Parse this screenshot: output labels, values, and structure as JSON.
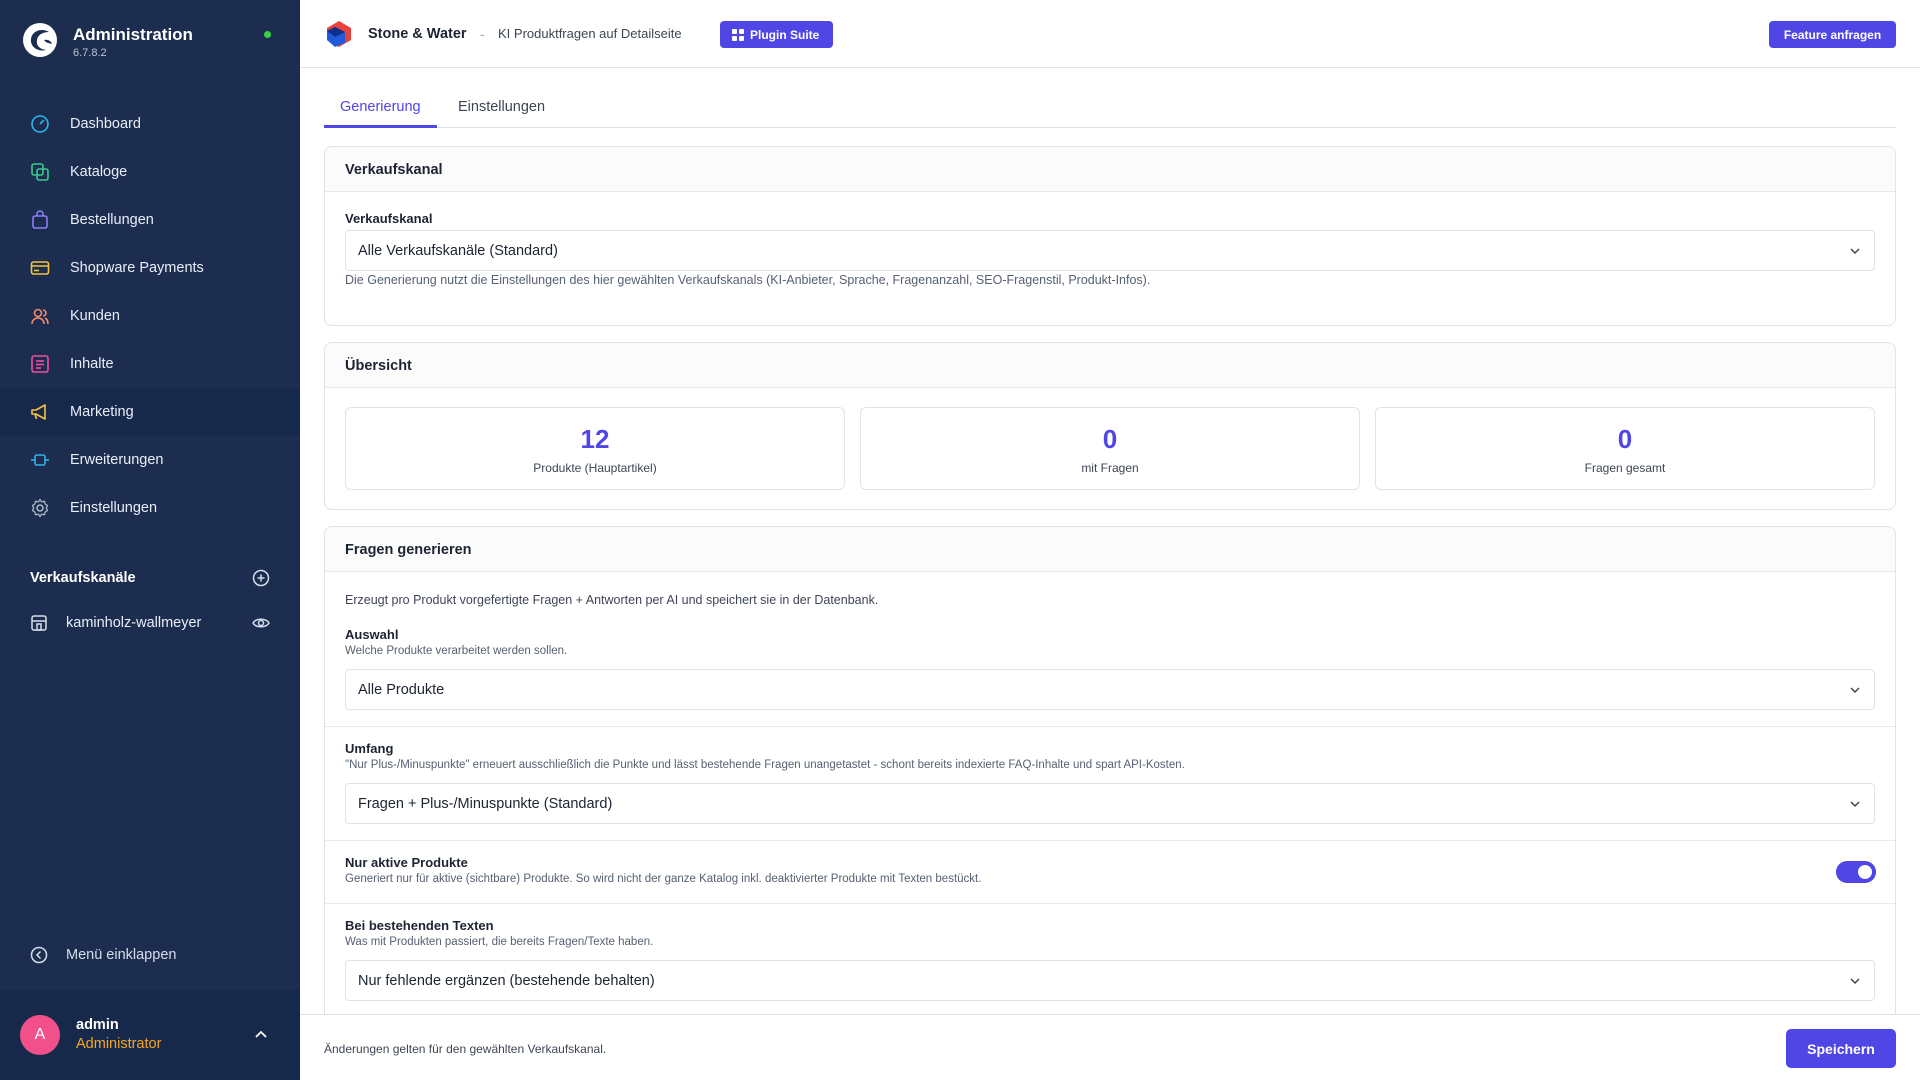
{
  "app": {
    "title": "Administration",
    "version": "6.7.8.2",
    "status_color": "#37d046"
  },
  "sidebar": {
    "items": [
      {
        "label": "Dashboard",
        "icon": "dashboard-icon",
        "color": "#2fb5e8"
      },
      {
        "label": "Kataloge",
        "icon": "catalog-icon",
        "color": "#38c98c"
      },
      {
        "label": "Bestellungen",
        "icon": "shopping-bag-icon",
        "color": "#8b7ff6"
      },
      {
        "label": "Shopware Payments",
        "icon": "credit-card-icon",
        "color": "#f5c242"
      },
      {
        "label": "Kunden",
        "icon": "users-icon",
        "color": "#f28a6b"
      },
      {
        "label": "Inhalte",
        "icon": "content-icon",
        "color": "#f04fa0"
      },
      {
        "label": "Marketing",
        "icon": "megaphone-icon",
        "color": "#f5c242",
        "active": true
      },
      {
        "label": "Erweiterungen",
        "icon": "plug-icon",
        "color": "#2fb5e8"
      },
      {
        "label": "Einstellungen",
        "icon": "gear-icon",
        "color": "#aab6c8"
      }
    ],
    "sales_channels_title": "Verkaufskanäle",
    "sales_channel": "kaminholz-wallmeyer",
    "collapse_label": "Menü einklappen"
  },
  "user": {
    "initial": "A",
    "name": "admin",
    "role": "Administrator"
  },
  "topbar": {
    "brand": "Stone & Water",
    "separator": "-",
    "subtitle": "KI Produktfragen auf Detailseite",
    "suite_button": "Plugin Suite",
    "feature_button": "Feature anfragen"
  },
  "tabs": [
    {
      "label": "Generierung",
      "active": true
    },
    {
      "label": "Einstellungen",
      "active": false
    }
  ],
  "channel_card": {
    "title": "Verkaufskanal",
    "label": "Verkaufskanal",
    "value": "Alle Verkaufskanäle (Standard)",
    "help": "Die Generierung nutzt die Einstellungen des hier gewählten Verkaufskanals (KI-Anbieter, Sprache, Fragenanzahl, SEO-Fragenstil, Produkt-Infos)."
  },
  "overview": {
    "title": "Übersicht",
    "stats": [
      {
        "value": "12",
        "label": "Produkte (Hauptartikel)"
      },
      {
        "value": "0",
        "label": "mit Fragen"
      },
      {
        "value": "0",
        "label": "Fragen gesamt"
      }
    ]
  },
  "generate": {
    "title": "Fragen generieren",
    "intro": "Erzeugt pro Produkt vorgefertigte Fragen + Antworten per AI und speichert sie in der Datenbank.",
    "selection": {
      "label": "Auswahl",
      "help": "Welche Produkte verarbeitet werden sollen.",
      "value": "Alle Produkte"
    },
    "scope": {
      "label": "Umfang",
      "help": "\"Nur Plus-/Minuspunkte\" erneuert ausschließlich die Punkte und lässt bestehende Fragen unangetastet - schont bereits indexierte FAQ-Inhalte und spart API-Kosten.",
      "value": "Fragen + Plus-/Minuspunkte (Standard)"
    },
    "active_only": {
      "label": "Nur aktive Produkte",
      "help": "Generiert nur für aktive (sichtbare) Produkte. So wird nicht der ganze Katalog inkl. deaktivierter Produkte mit Texten bestückt.",
      "enabled": true
    },
    "existing": {
      "label": "Bei bestehenden Texten",
      "help": "Was mit Produkten passiert, die bereits Fragen/Texte haben.",
      "value": "Nur fehlende ergänzen (bestehende behalten)"
    }
  },
  "footer": {
    "note": "Änderungen gelten für den gewählten Verkaufskanal.",
    "save_button": "Speichern"
  },
  "colors": {
    "accent": "#4f46e5",
    "sidebar_bg": "#1c2d4f",
    "sidebar_active": "#17294a",
    "role_color": "#f5a623",
    "avatar_bg": "#f2508a"
  }
}
